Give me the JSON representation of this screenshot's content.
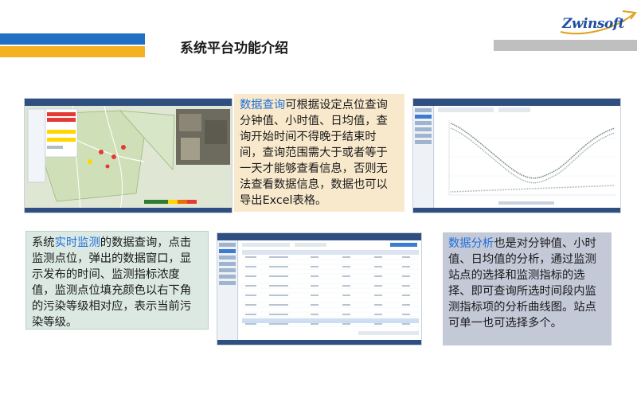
{
  "header": {
    "title": "系统平台功能介绍",
    "logo_text": "Zwinsoft"
  },
  "colors": {
    "accent_blue": "#1f6fc5",
    "accent_gold": "#f4b223",
    "highlight": "#1f6fd8",
    "box_query_bg": "#f8e9cc",
    "box_realtime_bg": "#dce9e3",
    "box_analysis_bg": "#c4c9d8"
  },
  "query_box": {
    "highlight": "数据查询",
    "text": "可根据设定点位查询分钟值、小时值、日均值，查询开始时间不得晚于结束时间，查询范围需大于或者等于一天才能够查看信息，否则无法查看数据信息，数据也可以导出Excel表格。"
  },
  "realtime_box": {
    "prefix": "系统",
    "highlight": "实时监测",
    "text": "的数据查询，点击监测点位，弹出的数据窗口，显示发布的时间、监测指标浓度值，监测点位填充颜色以右下角的污染等级相对应，表示当前污染等级。"
  },
  "analysis_box": {
    "highlight": "数据分析",
    "text": "也是对分钟值、小时值、日均值的分析，通过监测站点的选择和监测指标的选择、即可查询所选时间段内监测指标项的分析曲线图。站点可单一也可选择多个。"
  },
  "screenshots": {
    "map_icon": "map-screenshot",
    "chart_icon": "chart-screenshot",
    "table_icon": "table-screenshot"
  }
}
